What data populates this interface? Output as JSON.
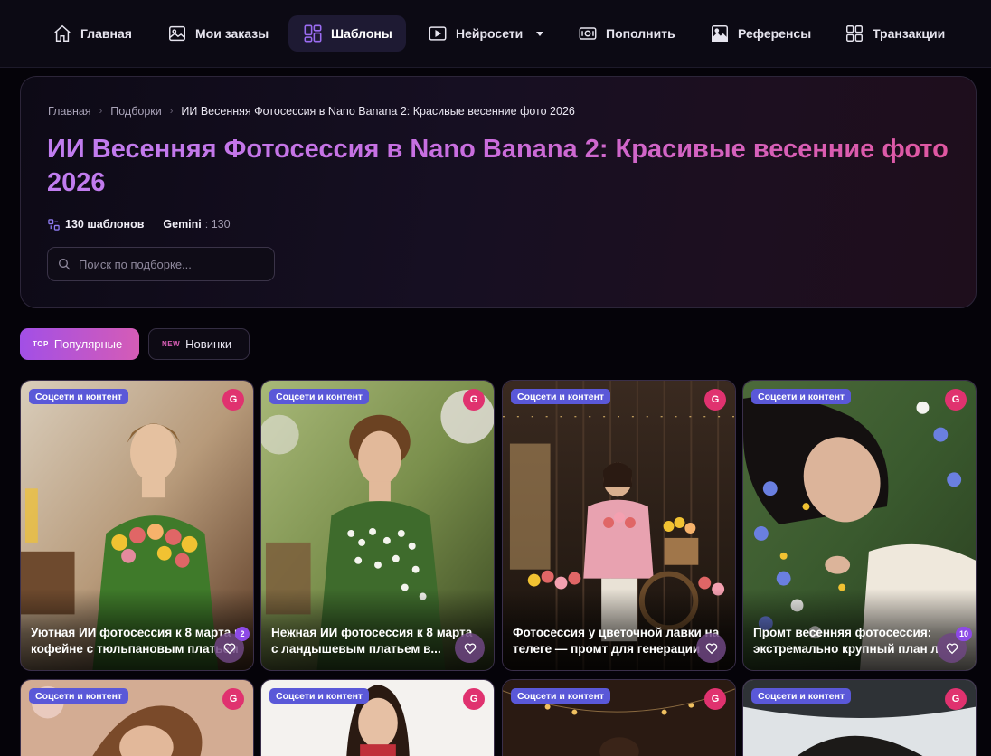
{
  "nav": {
    "items": [
      {
        "label": "Главная",
        "icon": "home-icon"
      },
      {
        "label": "Мои заказы",
        "icon": "image-icon"
      },
      {
        "label": "Шаблоны",
        "icon": "templates-icon",
        "active": true
      },
      {
        "label": "Нейросети",
        "icon": "play-icon",
        "dropdown": true
      },
      {
        "label": "Пополнить",
        "icon": "wallet-icon"
      },
      {
        "label": "Референсы",
        "icon": "picture-icon"
      },
      {
        "label": "Транзакции",
        "icon": "grid-icon"
      }
    ]
  },
  "breadcrumb": {
    "home": "Главная",
    "section": "Подборки",
    "current": "ИИ Весенняя Фотосессия в Nano Banana 2: Красивые весенние фото 2026"
  },
  "hero": {
    "title_line1": "ИИ Весенняя Фотосессия в Nano Banana 2: Красивые весенние фото",
    "title_line2": "2026",
    "templates_count": "130 шаблонов",
    "model_name": "Gemini",
    "model_count": ": 130",
    "search_placeholder": "Поиск по подборке..."
  },
  "filters": {
    "popular": {
      "tag": "TOP",
      "label": "Популярные",
      "active": true
    },
    "new": {
      "tag": "NEW",
      "label": "Новинки"
    }
  },
  "colors": {
    "accent_purple": "#a24fe6",
    "accent_pink": "#e0326f",
    "category_badge": "#5a58d8",
    "background": "#050309"
  },
  "cards": [
    {
      "category": "Соцсети и контент",
      "model_badge": "G",
      "title_line1": "Уютная ИИ фотосессия к 8 марта в",
      "title_line2": "кофейне с тюльпановым платьем",
      "likes": "2"
    },
    {
      "category": "Соцсети и контент",
      "model_badge": "G",
      "title_line1": "Нежная ИИ фотосессия к 8 марта",
      "title_line2": "с ландышевым платьем в...",
      "likes": ""
    },
    {
      "category": "Соцсети и контент",
      "model_badge": "G",
      "title_line1": "Фотосессия у цветочной лавки на",
      "title_line2": "телеге — промт для генерации",
      "likes": ""
    },
    {
      "category": "Соцсети и контент",
      "model_badge": "G",
      "title_line1": "Промт весенняя фотосессия:",
      "title_line2": "экстремально крупный план л",
      "likes": "10"
    },
    {
      "category": "Соцсети и контент",
      "model_badge": "G"
    },
    {
      "category": "Соцсети и контент",
      "model_badge": "G"
    },
    {
      "category": "Соцсети и контент",
      "model_badge": "G"
    },
    {
      "category": "Соцсети и контент",
      "model_badge": "G"
    }
  ]
}
